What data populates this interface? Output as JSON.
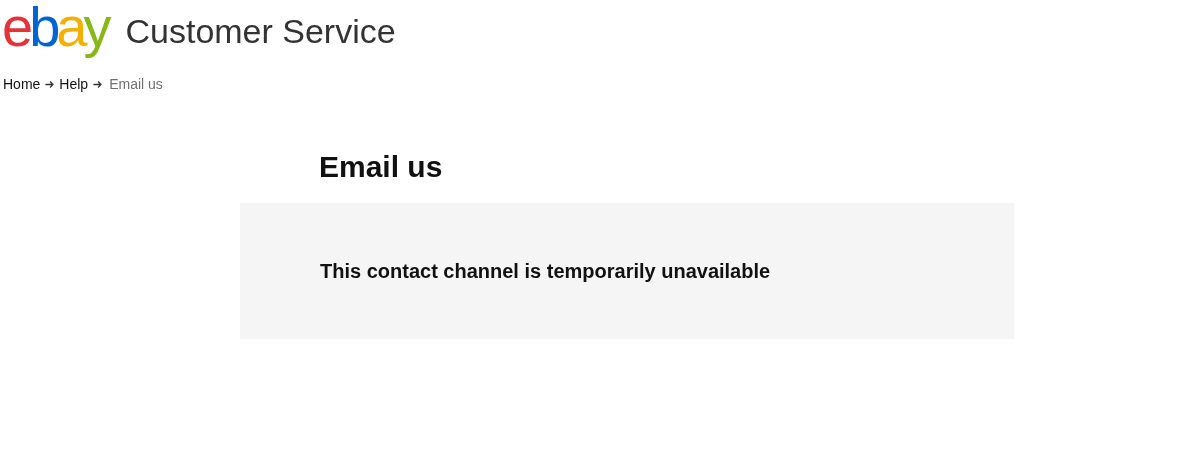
{
  "header": {
    "logo": [
      {
        "char": "e",
        "color": "#e53238"
      },
      {
        "char": "b",
        "color": "#0064d2"
      },
      {
        "char": "a",
        "color": "#f5af02"
      },
      {
        "char": "y",
        "color": "#86b817"
      }
    ],
    "title": "Customer Service"
  },
  "breadcrumb": [
    {
      "label": "Home",
      "current": false
    },
    {
      "label": "Help",
      "current": false
    },
    {
      "label": "Email us",
      "current": true
    }
  ],
  "heading": "Email us",
  "notice": "This contact channel is temporarily unavailable"
}
